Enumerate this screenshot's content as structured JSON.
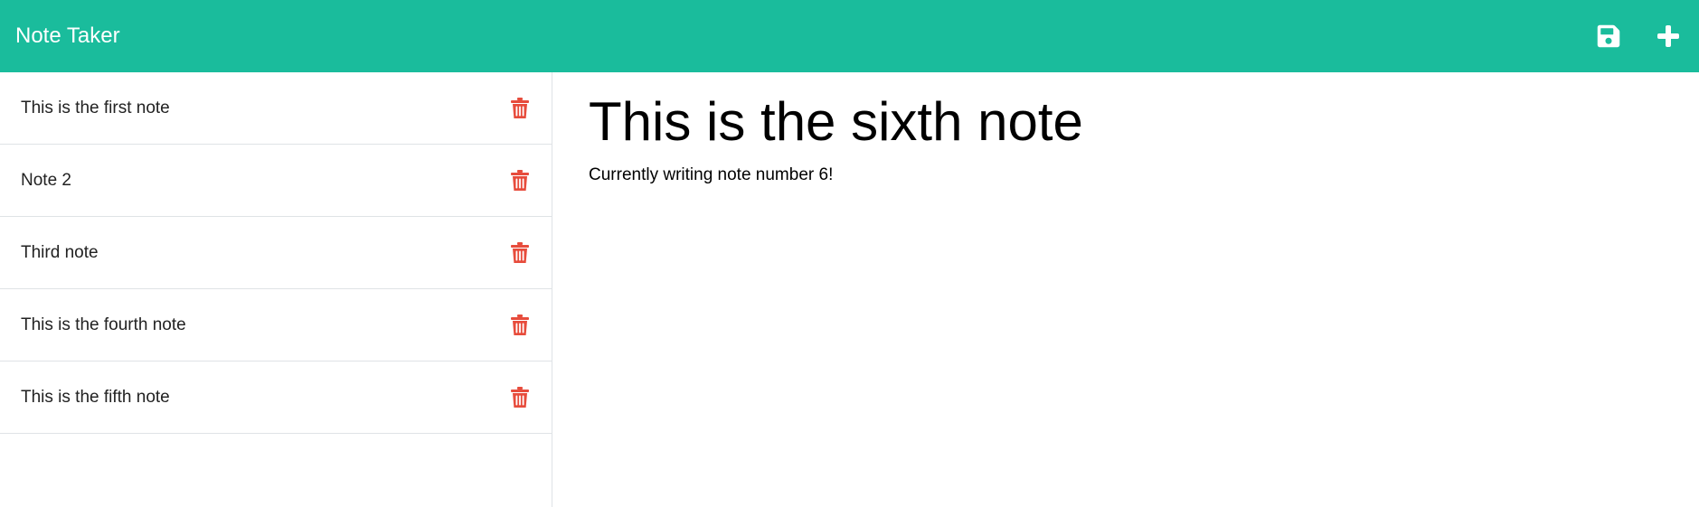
{
  "app": {
    "title": "Note Taker"
  },
  "toolbar": {
    "icons": [
      "save-icon",
      "plus-icon"
    ]
  },
  "colors": {
    "accent": "#1abc9c",
    "delete": "#e74c3c",
    "icon": "#ffffff"
  },
  "sidebar": {
    "notes": [
      {
        "label": "This is the first note",
        "icon": "trash-icon"
      },
      {
        "label": "Note 2",
        "icon": "trash-icon"
      },
      {
        "label": "Third note",
        "icon": "trash-icon"
      },
      {
        "label": "This is the fourth note",
        "icon": "trash-icon"
      },
      {
        "label": "This is the fifth note",
        "icon": "trash-icon"
      }
    ]
  },
  "editor": {
    "title_value": "This is the sixth note",
    "body_value": "Currently writing note number 6!"
  }
}
